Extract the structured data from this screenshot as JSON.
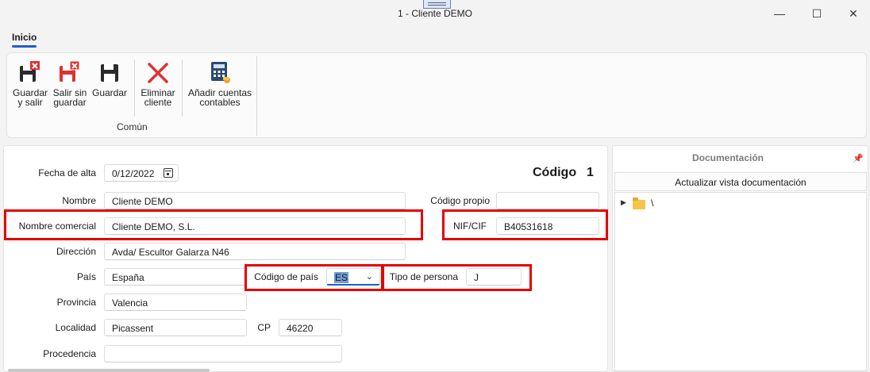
{
  "window": {
    "title": "1 - Cliente DEMO",
    "minimize_glyph": "—",
    "maximize_glyph": "☐",
    "close_glyph": "✕"
  },
  "ribbon": {
    "tab_label": "Inicio",
    "buttons": {
      "guardar_salir": {
        "line1": "Guardar",
        "line2": "y salir",
        "icon": "save-close-icon"
      },
      "salir_sin_guardar": {
        "line1": "Salir sin",
        "line2": "guardar",
        "icon": "exit-no-save-icon"
      },
      "guardar": {
        "line1": "Guardar",
        "line2": "",
        "icon": "save-icon"
      },
      "eliminar_cliente": {
        "line1": "Eliminar",
        "line2": "cliente",
        "icon": "delete-x-icon"
      },
      "anadir_cuentas": {
        "line1": "Añadir cuentas",
        "line2": "contables",
        "icon": "accounts-calculator-icon"
      }
    },
    "group_label": "Común"
  },
  "form": {
    "codigo_label": "Código",
    "codigo_value": "1",
    "fecha_alta": {
      "label": "Fecha de alta",
      "value": "0/12/2022"
    },
    "nombre": {
      "label": "Nombre",
      "value": "Cliente DEMO"
    },
    "codigo_propio": {
      "label": "Código propio",
      "value": ""
    },
    "nombre_comercial": {
      "label": "Nombre comercial",
      "value": "Cliente DEMO, S.L."
    },
    "nif_cif": {
      "label": "NIF/CIF",
      "value": "B40531618"
    },
    "direccion": {
      "label": "Dirección",
      "value": "Avda/ Escultor Galarza N46"
    },
    "pais": {
      "label": "País",
      "value": "España"
    },
    "codigo_pais": {
      "label": "Código de país",
      "value": "ES"
    },
    "tipo_persona": {
      "label": "Tipo de persona",
      "value": "J"
    },
    "provincia": {
      "label": "Provincia",
      "value": "Valencia"
    },
    "localidad": {
      "label": "Localidad",
      "value": "Picassent"
    },
    "cp": {
      "label": "CP",
      "value": "46220"
    },
    "procedencia": {
      "label": "Procedencia",
      "value": ""
    }
  },
  "documentation": {
    "title": "Documentación",
    "update_button": "Actualizar vista documentación",
    "tree_root": "\\"
  },
  "colors": {
    "highlight_box": "#e60000",
    "accent": "#1f5fc7"
  }
}
